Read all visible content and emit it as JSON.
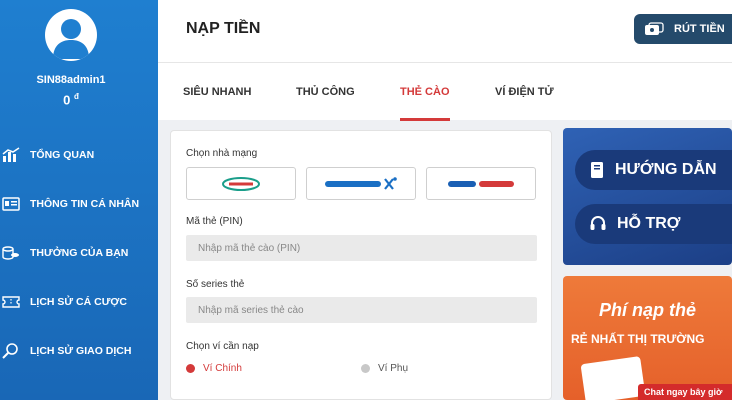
{
  "sidebar": {
    "username": "SIN88admin1",
    "balance": "0",
    "currency": "đ",
    "items": [
      {
        "label": "TỔNG QUAN",
        "icon": "chart-icon"
      },
      {
        "label": "THÔNG TIN CÁ NHÂN",
        "icon": "id-card-icon"
      },
      {
        "label": "THƯỞNG CỦA BẠN",
        "icon": "coins-icon"
      },
      {
        "label": "LỊCH SỬ CÁ CƯỢC",
        "icon": "ticket-icon"
      },
      {
        "label": "LỊCH SỬ GIAO DỊCH",
        "icon": "search-history-icon"
      }
    ]
  },
  "header": {
    "title": "NẠP TIỀN",
    "withdraw_label": "RÚT TIỀN"
  },
  "tabs": [
    {
      "label": "SIÊU NHANH",
      "active": false
    },
    {
      "label": "THỦ CÔNG",
      "active": false
    },
    {
      "label": "THẺ CÀO",
      "active": true
    },
    {
      "label": "VÍ ĐIỆN TỬ",
      "active": false
    }
  ],
  "form": {
    "carrier_label": "Chọn nhà mạng",
    "carriers": [
      "viettel",
      "vinaphone",
      "mobifone"
    ],
    "pin_label": "Mã thẻ (PIN)",
    "pin_placeholder": "Nhập mã thẻ cào (PIN)",
    "serial_label": "Số series thẻ",
    "serial_placeholder": "Nhập mã series thẻ cào",
    "wallet_label": "Chọn ví cần nạp",
    "wallet_main": "Ví Chính",
    "wallet_sub": "Ví Phụ"
  },
  "side": {
    "guide_label": "HƯỚNG DẪN",
    "support_label": "HỖ TRỢ",
    "promo_title": "Phí nạp thẻ",
    "promo_sub": "RẺ NHẤT THỊ TRƯỜNG",
    "chat_label": "Chat ngay bây giờ"
  },
  "colors": {
    "sidebar": "#1f7fd0",
    "accent": "#d43a3a",
    "withdraw_btn": "#244a6b",
    "guide_panel": "#2f62b5",
    "promo": "#ee7a3a"
  }
}
